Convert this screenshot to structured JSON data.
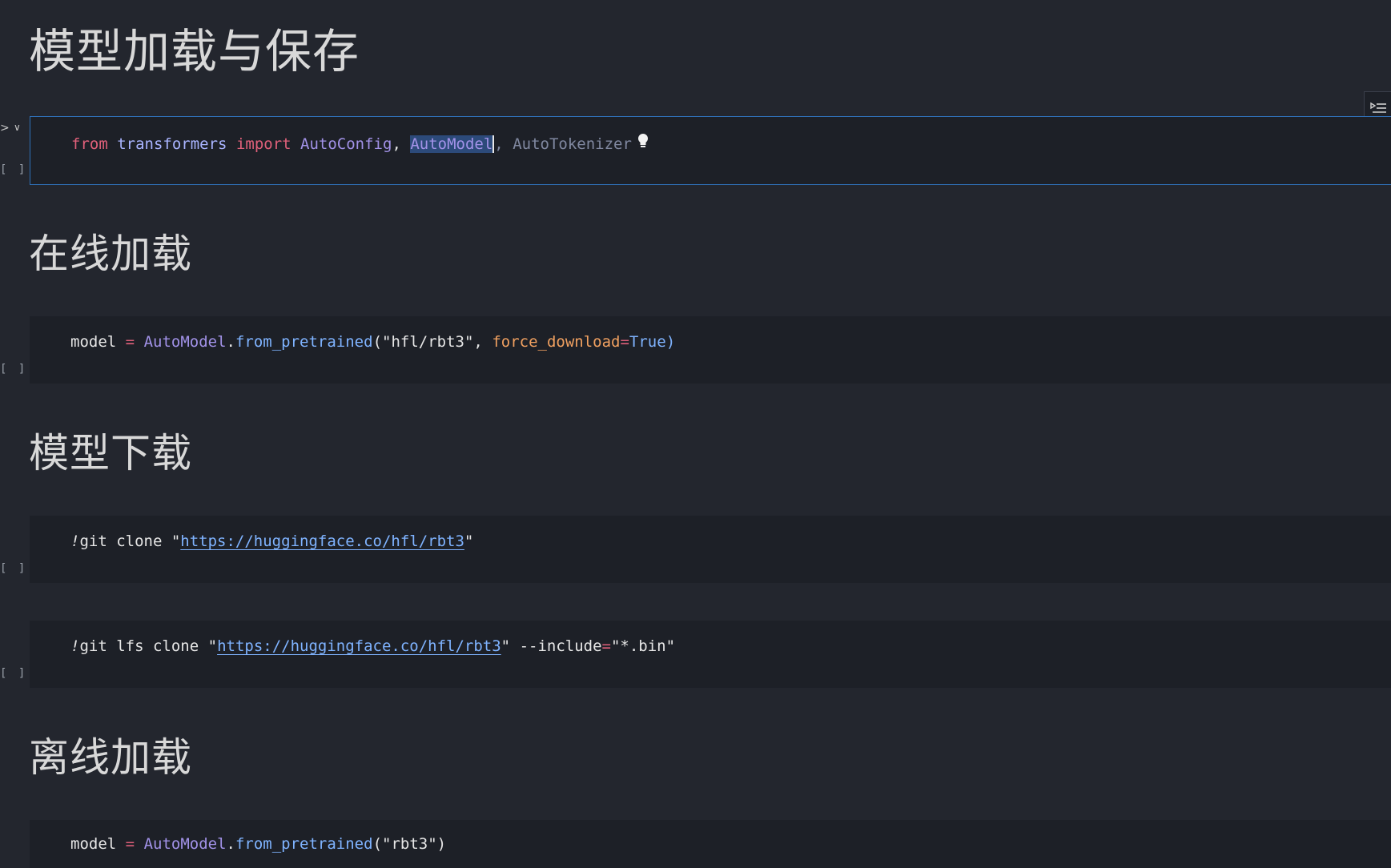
{
  "headings": {
    "title": "模型加载与保存",
    "online": "在线加载",
    "download": "模型下载",
    "offline": "离线加载"
  },
  "cells": {
    "c1": {
      "exec": "[ ]",
      "t_from": "from",
      "t_module": "transformers",
      "t_import": "import",
      "t_config": "AutoConfig",
      "t_comma1": ",",
      "t_model": "AutoModel",
      "t_comma2": ",",
      "t_tokenizer": "AutoTokenizer"
    },
    "c2": {
      "exec": "[ ]",
      "t_var": "model",
      "t_eq": "=",
      "t_cls": "AutoModel",
      "t_dot": ".",
      "t_fn": "from_pretrained",
      "t_open": "(",
      "t_str": "\"hfl/rbt3\"",
      "t_comma": ",",
      "t_param": "force_download",
      "t_eq2": "=",
      "t_bool": "True",
      "t_close": ")"
    },
    "c3": {
      "exec": "[ ]",
      "t_bang": "!",
      "t_cmd": "git clone ",
      "t_q1": "\"",
      "t_url": "https://huggingface.co/hfl/rbt3",
      "t_q2": "\""
    },
    "c4": {
      "exec": "[ ]",
      "t_bang": "!",
      "t_cmd": "git lfs clone ",
      "t_q1": "\"",
      "t_url": "https://huggingface.co/hfl/rbt3",
      "t_q2": "\"",
      "t_flag": " --include",
      "t_eq": "=",
      "t_pat": "\"*.bin\""
    },
    "c5": {
      "t_var": "model",
      "t_eq": "=",
      "t_cls": "AutoModel",
      "t_dot": ".",
      "t_fn": "from_pretrained",
      "t_open": "(",
      "t_str": "\"rbt3\"",
      "t_close": ")"
    }
  },
  "icons": {
    "run": "run-arrow-icon",
    "collapse": "chevron-down-icon",
    "bulb": "lightbulb-icon",
    "toolbar": "outline-toggle-icon"
  },
  "colors": {
    "background": "#23262e",
    "cell_background": "#1d2027",
    "focus_border": "#2f6fb5",
    "keyword": "#e0607a",
    "class": "#a292e8",
    "function": "#7fb3ff",
    "parameter": "#f0a060"
  }
}
